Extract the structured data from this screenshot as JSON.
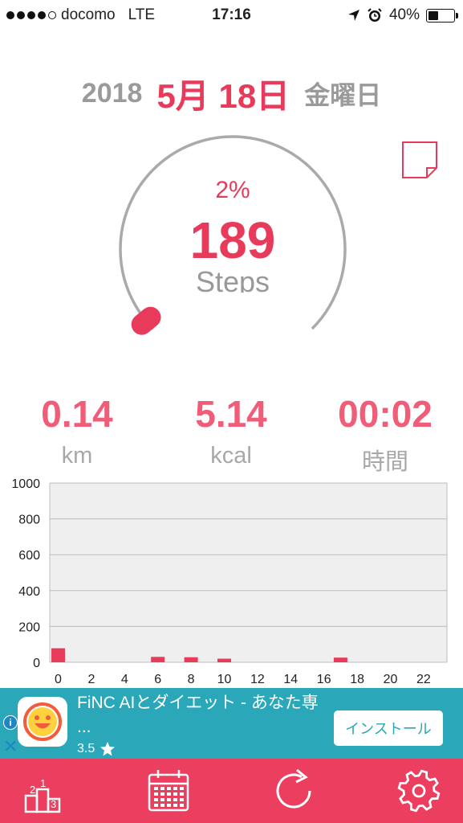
{
  "status_bar": {
    "carrier": "docomo",
    "network": "LTE",
    "time": "17:16",
    "battery": "40%",
    "battery_level": 0.4,
    "signal_dots_filled": 4,
    "signal_dots_total": 5,
    "icons": [
      "location-arrow-icon",
      "alarm-icon",
      "battery-icon"
    ]
  },
  "date": {
    "year": "2018",
    "day": "5月 18日",
    "weekday": "金曜日"
  },
  "progress": {
    "percent": "2%",
    "percent_value": 0.02,
    "steps": "189",
    "steps_label": "Steps"
  },
  "stats": [
    {
      "value": "0.14",
      "unit": "km"
    },
    {
      "value": "5.14",
      "unit": "kcal"
    },
    {
      "value": "00:02",
      "unit": "時間"
    }
  ],
  "chart_data": {
    "type": "bar",
    "categories": [
      "0",
      "1",
      "2",
      "3",
      "4",
      "5",
      "6",
      "7",
      "8",
      "9",
      "10",
      "11",
      "12",
      "13",
      "14",
      "15",
      "16",
      "17",
      "18",
      "19",
      "20",
      "21",
      "22",
      "23"
    ],
    "x_tick_labels": [
      "0",
      "2",
      "4",
      "6",
      "8",
      "10",
      "12",
      "14",
      "16",
      "18",
      "20",
      "22"
    ],
    "values": [
      78,
      0,
      0,
      0,
      0,
      0,
      30,
      0,
      28,
      0,
      20,
      0,
      0,
      0,
      0,
      0,
      0,
      26,
      0,
      0,
      0,
      0,
      0,
      0
    ],
    "y_ticks": [
      "1000",
      "800",
      "600",
      "400",
      "200",
      "0"
    ],
    "ylim": [
      0,
      1000
    ],
    "grid": true,
    "title": "",
    "xlabel": "",
    "ylabel": ""
  },
  "ad": {
    "title": "FiNC AIとダイエット - あなた専 ...",
    "rating": "3.5",
    "install_label": "インストール",
    "info_label": "i",
    "close_label": "✕"
  },
  "tabbar": {
    "ranking_labels": [
      "2",
      "1",
      "3"
    ]
  },
  "colors": {
    "accent": "#e83a5b",
    "stat": "#f05d78",
    "tabbar": "#ec3e5e",
    "ad": "#2aa7b8",
    "bar": "#e83a5b",
    "chart_bg": "#efefef"
  }
}
